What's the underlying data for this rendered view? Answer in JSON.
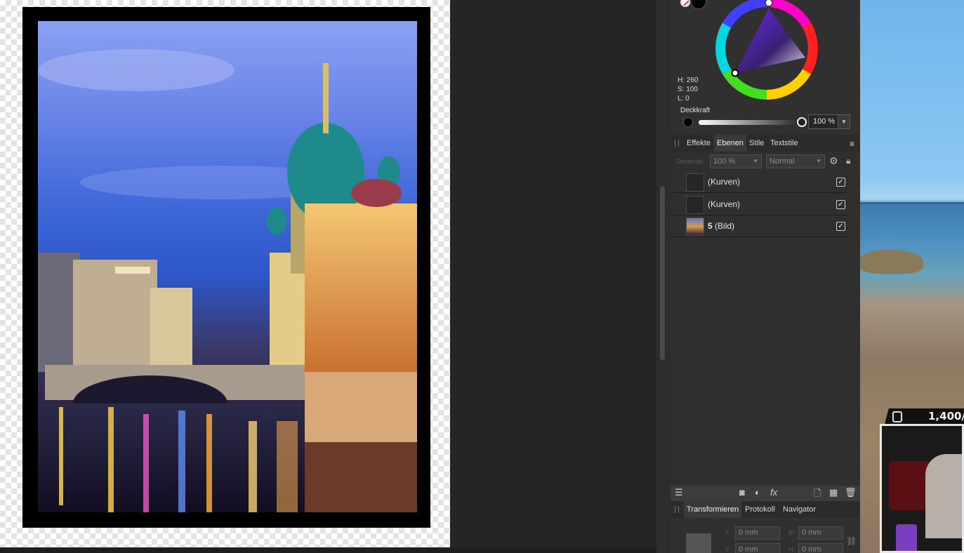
{
  "color_panel": {
    "h": "H: 260",
    "s": "S: 100",
    "l": "L: 0",
    "opacity_label": "Deckkraft",
    "opacity_value": "100 %",
    "opacity_fraction": 1.0
  },
  "tabs_top": {
    "effects": "Effekte",
    "layers": "Ebenen",
    "styles": "Stile",
    "text_styles": "Textstile",
    "active": "Ebenen"
  },
  "layer_controls": {
    "opacity_label": "Deckkraft:",
    "opacity_value": "100 %",
    "blend_mode": "Normal"
  },
  "layers": [
    {
      "num": "",
      "name": "(Kurven)",
      "checked": true
    },
    {
      "num": "",
      "name": "(Kurven)",
      "checked": true
    },
    {
      "num": "5",
      "name": " (Bild)",
      "checked": true
    }
  ],
  "tabs_bottom": {
    "transform": "Transformieren",
    "history": "Protokoll",
    "navigator": "Navigator",
    "active": "Transformieren"
  },
  "transform": {
    "x_label": "X:",
    "x_value": "0 mm",
    "y_label": "Y:",
    "y_value": "0 mm",
    "w_label": "Br:",
    "w_value": "0 mm",
    "h_label": "H:",
    "h_value": "0 mm"
  },
  "stream_overlay": {
    "counter": "1,400/"
  },
  "colors": {
    "panel_bg": "#303030",
    "accent_hue_violet": "#5a1fd6"
  },
  "icons": [
    "no-fill-icon",
    "black-swatch-icon",
    "color-wheel-icon",
    "panel-menu-icon",
    "gear-icon",
    "lock-icon",
    "checkbox-icon",
    "layers-icon",
    "mask-icon",
    "adjustment-icon",
    "fx-icon",
    "new-layer-icon",
    "pixel-layer-icon",
    "trash-icon",
    "anchor-grid-icon",
    "link-icon"
  ]
}
